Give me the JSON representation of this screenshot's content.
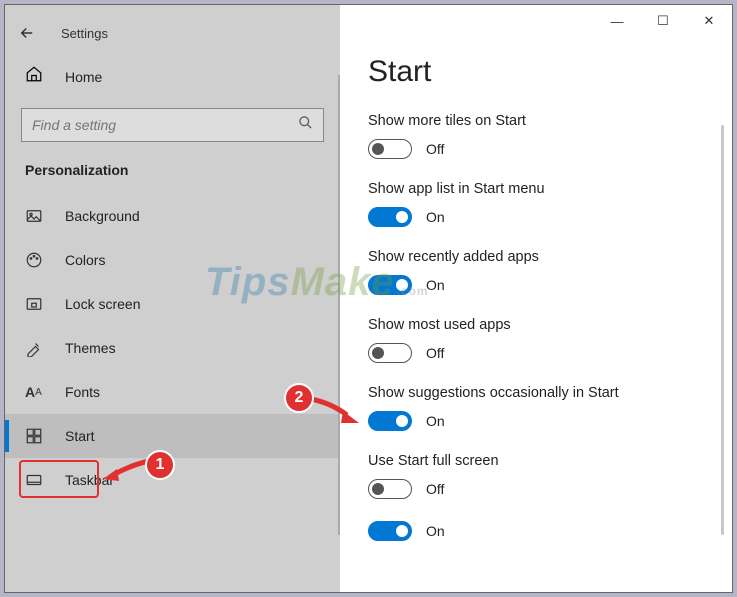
{
  "titlebar": {
    "app_name": "Settings"
  },
  "window_controls": {
    "min": "—",
    "max": "☐",
    "close": "✕"
  },
  "home": {
    "label": "Home"
  },
  "search": {
    "placeholder": "Find a setting"
  },
  "category": {
    "label": "Personalization"
  },
  "nav": {
    "items": [
      {
        "label": "Background"
      },
      {
        "label": "Colors"
      },
      {
        "label": "Lock screen"
      },
      {
        "label": "Themes"
      },
      {
        "label": "Fonts"
      },
      {
        "label": "Start"
      },
      {
        "label": "Taskbar"
      }
    ]
  },
  "page": {
    "title": "Start"
  },
  "settings": [
    {
      "label": "Show more tiles on Start",
      "value": false,
      "state": "Off"
    },
    {
      "label": "Show app list in Start menu",
      "value": true,
      "state": "On"
    },
    {
      "label": "Show recently added apps",
      "value": true,
      "state": "On"
    },
    {
      "label": "Show most used apps",
      "value": false,
      "state": "Off"
    },
    {
      "label": "Show suggestions occasionally in Start",
      "value": true,
      "state": "On"
    },
    {
      "label": "Use Start full screen",
      "value": false,
      "state": "Off"
    },
    {
      "label": "",
      "value": true,
      "state": "On"
    }
  ],
  "annotations": {
    "badge1": "1",
    "badge2": "2"
  },
  "watermark": {
    "t": "Tips",
    "m": "Make",
    "com": ".com"
  }
}
